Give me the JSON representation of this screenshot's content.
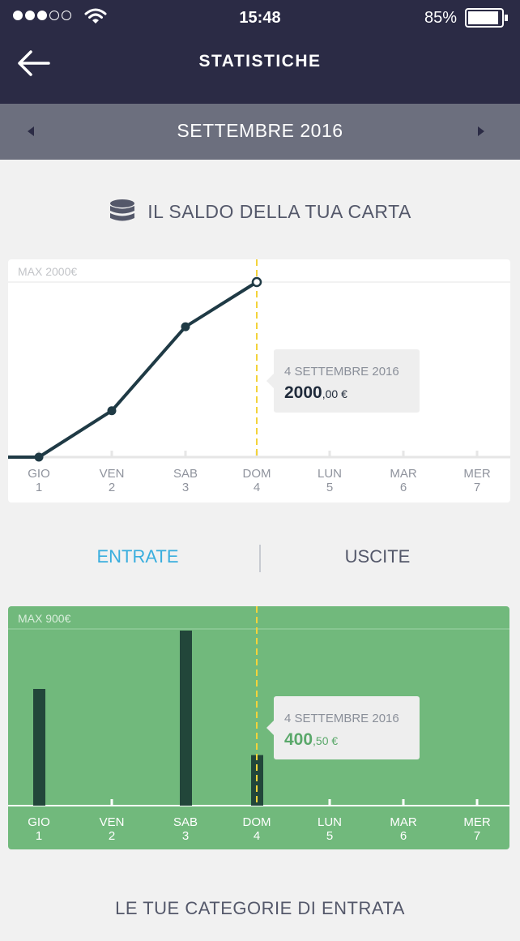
{
  "status_bar": {
    "time": "15:48",
    "battery": "85%"
  },
  "header": {
    "title": "STATISTICHE"
  },
  "month_selector": {
    "label": "SETTEMBRE 2016"
  },
  "balance": {
    "heading": "IL SALDO DELLA TUA CARTA",
    "tooltip": {
      "date": "4 SETTEMBRE 2016",
      "value_main": "2000",
      "value_cents": ",00 €"
    }
  },
  "tabs": {
    "income": "ENTRATE",
    "expenses": "USCITE"
  },
  "income": {
    "tooltip": {
      "date": "4 SETTEMBRE 2016",
      "value_main": "400",
      "value_cents": ",50 €"
    }
  },
  "categories_heading": "LE TUE CATEGORIE DI ENTRATA",
  "colors": {
    "dark": "#2b2b45",
    "accent_blue": "#3aaede",
    "income_green": "#71b97c",
    "bar_dark": "#22463a",
    "line": "#1f3a45",
    "marker": "#f3d33a"
  },
  "chart_data": [
    {
      "type": "line",
      "title": "IL SALDO DELLA TUA CARTA",
      "max_label": "MAX 2000€",
      "ylim": [
        0,
        2000
      ],
      "x": [
        {
          "day": "GIO",
          "date": "1"
        },
        {
          "day": "VEN",
          "date": "2"
        },
        {
          "day": "SAB",
          "date": "3"
        },
        {
          "day": "DOM",
          "date": "4"
        },
        {
          "day": "LUN",
          "date": "5"
        },
        {
          "day": "MAR",
          "date": "6"
        },
        {
          "day": "MER",
          "date": "7"
        }
      ],
      "values": [
        0,
        530,
        1490,
        2000
      ],
      "selected_index": 3
    },
    {
      "type": "bar",
      "title": "ENTRATE",
      "max_label": "MAX 900€",
      "ylim": [
        0,
        900
      ],
      "x": [
        {
          "day": "GIO",
          "date": "1"
        },
        {
          "day": "VEN",
          "date": "2"
        },
        {
          "day": "SAB",
          "date": "3"
        },
        {
          "day": "DOM",
          "date": "4"
        },
        {
          "day": "LUN",
          "date": "5"
        },
        {
          "day": "MAR",
          "date": "6"
        },
        {
          "day": "MER",
          "date": "7"
        }
      ],
      "values": [
        600,
        0,
        900,
        260,
        0,
        0,
        0
      ],
      "selected_index": 3
    }
  ]
}
